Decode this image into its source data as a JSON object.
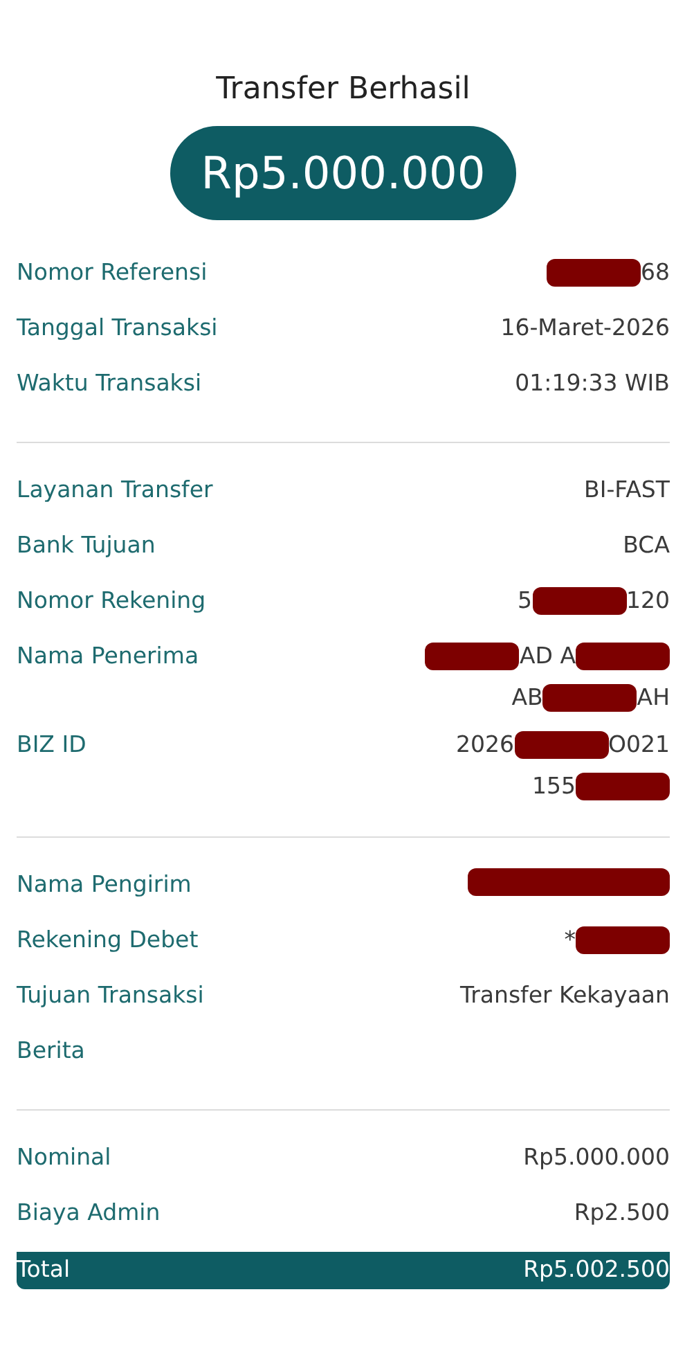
{
  "title": "Transfer Berhasil",
  "amount": "Rp5.000.000",
  "sections": [
    {
      "rows": [
        {
          "label": "Nomor Referensi",
          "lines": [
            [
              {
                "kind": "redacted"
              },
              {
                "kind": "text",
                "text": "68"
              }
            ]
          ]
        },
        {
          "label": "Tanggal Transaksi",
          "lines": [
            [
              {
                "kind": "text",
                "text": "16-Maret-2026"
              }
            ]
          ]
        },
        {
          "label": "Waktu Transaksi",
          "lines": [
            [
              {
                "kind": "text",
                "text": "01:19:33 WIB"
              }
            ]
          ]
        }
      ]
    },
    {
      "rows": [
        {
          "label": "Layanan Transfer",
          "lines": [
            [
              {
                "kind": "text",
                "text": "BI-FAST"
              }
            ]
          ]
        },
        {
          "label": "Bank Tujuan",
          "lines": [
            [
              {
                "kind": "text",
                "text": "BCA"
              }
            ]
          ]
        },
        {
          "label": "Nomor Rekening",
          "lines": [
            [
              {
                "kind": "text",
                "text": "5"
              },
              {
                "kind": "redacted"
              },
              {
                "kind": "text",
                "text": "120"
              }
            ]
          ]
        },
        {
          "label": "Nama Penerima",
          "lines": [
            [
              {
                "kind": "redacted"
              },
              {
                "kind": "text",
                "text": "AD A"
              },
              {
                "kind": "redacted"
              }
            ],
            [
              {
                "kind": "text",
                "text": "AB"
              },
              {
                "kind": "redacted"
              },
              {
                "kind": "text",
                "text": "AH"
              }
            ]
          ]
        },
        {
          "label": "BIZ ID",
          "lines": [
            [
              {
                "kind": "text",
                "text": "2026"
              },
              {
                "kind": "redacted"
              },
              {
                "kind": "text",
                "text": "O021"
              }
            ],
            [
              {
                "kind": "text",
                "text": "155"
              },
              {
                "kind": "redacted"
              }
            ]
          ]
        }
      ]
    },
    {
      "rows": [
        {
          "label": "Nama Pengirim",
          "lines": [
            [
              {
                "kind": "redacted"
              }
            ]
          ]
        },
        {
          "label": "Rekening Debet",
          "lines": [
            [
              {
                "kind": "text",
                "text": "*"
              },
              {
                "kind": "redacted"
              }
            ]
          ]
        },
        {
          "label": "Tujuan Transaksi",
          "lines": [
            [
              {
                "kind": "text",
                "text": "Transfer Kekayaan"
              }
            ]
          ]
        },
        {
          "label": "Berita",
          "lines": []
        }
      ]
    },
    {
      "rows": [
        {
          "label": "Nominal",
          "lines": [
            [
              {
                "kind": "text",
                "text": "Rp5.000.000"
              }
            ]
          ]
        },
        {
          "label": "Biaya Admin",
          "lines": [
            [
              {
                "kind": "text",
                "text": "Rp2.500"
              }
            ]
          ]
        }
      ]
    }
  ],
  "total": {
    "label": "Total",
    "value": "Rp5.002.500"
  }
}
